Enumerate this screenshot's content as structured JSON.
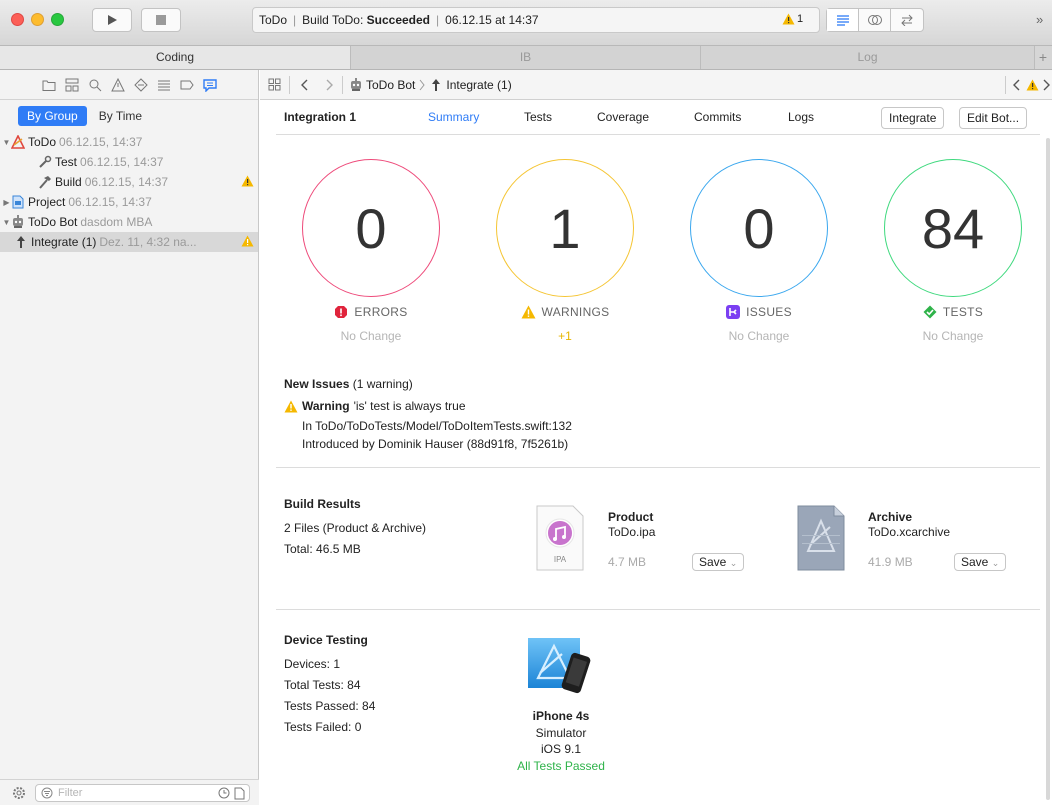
{
  "toolbar": {
    "activity": {
      "app": "ToDo",
      "build_label": "Build ToDo:",
      "build_status": "Succeeded",
      "timestamp": "06.12.15 at 14:37",
      "warning_count": "1"
    },
    "overflow": "»"
  },
  "tabs": [
    "Coding",
    "IB",
    "Log"
  ],
  "navigator": {
    "group_toggle": {
      "by_group": "By Group",
      "by_time": "By Time"
    },
    "rows": [
      {
        "label": "ToDo",
        "detail": "06.12.15, 14:37"
      },
      {
        "label": "Test",
        "detail": "06.12.15, 14:37"
      },
      {
        "label": "Build",
        "detail": "06.12.15, 14:37"
      },
      {
        "label": "Project",
        "detail": "06.12.15, 14:37"
      },
      {
        "label": "ToDo Bot",
        "detail": "dasdom MBA"
      },
      {
        "label": "Integrate (1)",
        "detail": "Dez. 11, 4:32 na..."
      }
    ],
    "filter_placeholder": "Filter"
  },
  "jumpbar": {
    "bot": "ToDo Bot",
    "integration": "Integrate (1)"
  },
  "integration": {
    "title": "Integration 1",
    "tabs": [
      "Summary",
      "Tests",
      "Coverage",
      "Commits",
      "Logs"
    ],
    "integrate_button": "Integrate",
    "edit_button": "Edit Bot..."
  },
  "summary": {
    "errors": {
      "value": "0",
      "label": "ERRORS",
      "change": "No Change",
      "color": "#ee4a7a"
    },
    "warnings": {
      "value": "1",
      "label": "WARNINGS",
      "change": "+1",
      "color": "#f5c533"
    },
    "issues": {
      "value": "0",
      "label": "ISSUES",
      "change": "No Change",
      "color": "#3aa7ee"
    },
    "tests": {
      "value": "84",
      "label": "TESTS",
      "change": "No Change",
      "color": "#3fd97e"
    }
  },
  "new_issues": {
    "title": "New Issues",
    "count": "(1 warning)",
    "warning_label": "Warning",
    "warning_text": "'is' test is always true",
    "location": "In ToDo/ToDoTests/Model/ToDoItemTests.swift:132",
    "introduced": "Introduced by Dominik Hauser (88d91f8, 7f5261b)"
  },
  "build_results": {
    "title": "Build Results",
    "files": "2 Files (Product & Archive)",
    "total": "Total: 46.5 MB",
    "product": {
      "title": "Product",
      "file": "ToDo.ipa",
      "size": "4.7 MB",
      "save": "Save",
      "icon_label": "IPA"
    },
    "archive": {
      "title": "Archive",
      "file": "ToDo.xcarchive",
      "size": "41.9 MB",
      "save": "Save"
    }
  },
  "device_testing": {
    "title": "Device Testing",
    "devices": "Devices: 1",
    "total_tests": "Total Tests: 84",
    "passed": "Tests Passed: 84",
    "failed": "Tests Failed: 0",
    "device_name": "iPhone 4s",
    "device_type": "Simulator",
    "os": "iOS 9.1",
    "result": "All Tests Passed"
  }
}
